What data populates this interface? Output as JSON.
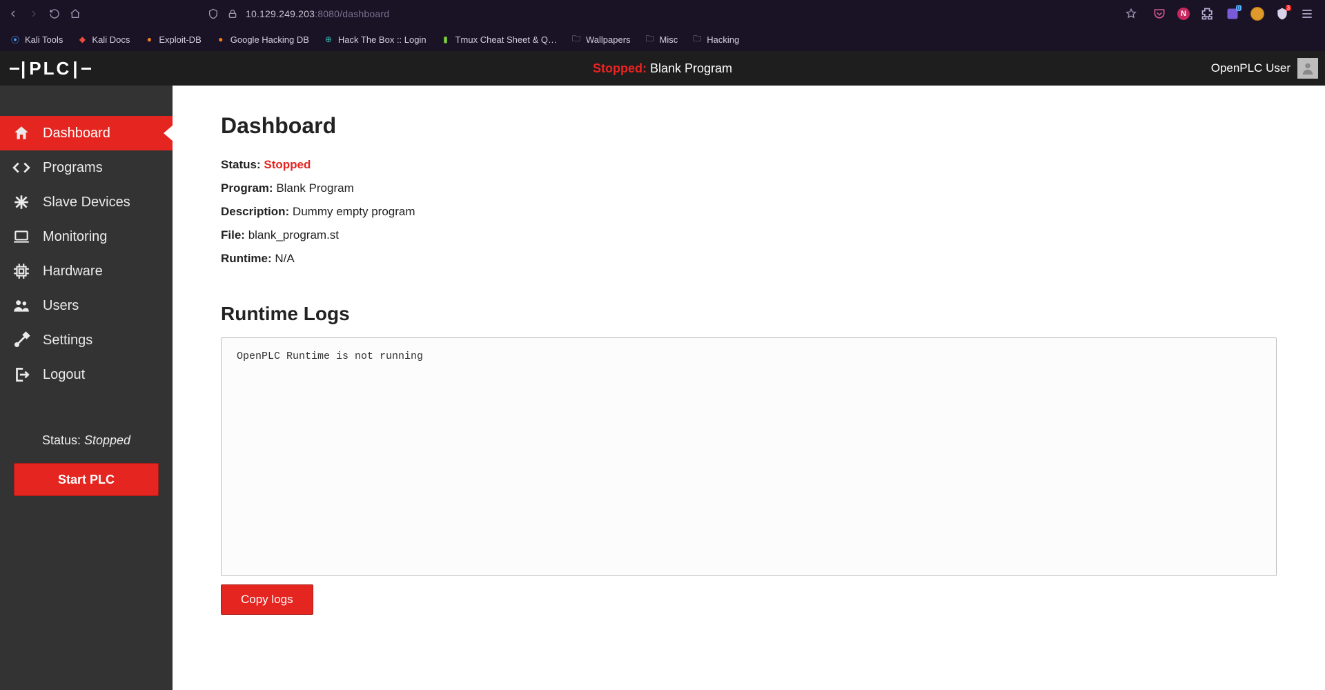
{
  "browser": {
    "url_host": "10.129.249.203",
    "url_port": ":8080",
    "url_path": "/dashboard",
    "bookmarks": [
      {
        "label": "Kali Tools",
        "favClass": "fav-blue",
        "glyph": "⦿"
      },
      {
        "label": "Kali Docs",
        "favClass": "fav-red",
        "glyph": "◆"
      },
      {
        "label": "Exploit-DB",
        "favClass": "fav-orange",
        "glyph": "●"
      },
      {
        "label": "Google Hacking DB",
        "favClass": "fav-orange",
        "glyph": "●"
      },
      {
        "label": "Hack The Box :: Login",
        "favClass": "fav-teal",
        "glyph": "⊕"
      },
      {
        "label": "Tmux Cheat Sheet & Q…",
        "favClass": "fav-green",
        "glyph": "▮"
      },
      {
        "label": "Wallpapers",
        "favClass": "fav-folder",
        "glyph": "🗀"
      },
      {
        "label": "Misc",
        "favClass": "fav-folder",
        "glyph": "🗀"
      },
      {
        "label": "Hacking",
        "favClass": "fav-folder",
        "glyph": "🗀"
      }
    ]
  },
  "header": {
    "logo_text": "PLC",
    "status_word": "Stopped:",
    "program_name": "Blank Program",
    "user_label": "OpenPLC User"
  },
  "sidebar": {
    "items": [
      {
        "label": "Dashboard",
        "icon": "home",
        "active": true
      },
      {
        "label": "Programs",
        "icon": "code",
        "active": false
      },
      {
        "label": "Slave Devices",
        "icon": "asterisk",
        "active": false
      },
      {
        "label": "Monitoring",
        "icon": "laptop",
        "active": false
      },
      {
        "label": "Hardware",
        "icon": "chip",
        "active": false
      },
      {
        "label": "Users",
        "icon": "users",
        "active": false
      },
      {
        "label": "Settings",
        "icon": "settings",
        "active": false
      },
      {
        "label": "Logout",
        "icon": "logout",
        "active": false
      }
    ],
    "status_prefix": "Status: ",
    "status_value": "Stopped",
    "start_button": "Start PLC"
  },
  "dashboard": {
    "title": "Dashboard",
    "rows": {
      "status_label": "Status:",
      "status_value": "Stopped",
      "program_label": "Program:",
      "program_value": "Blank Program",
      "desc_label": "Description:",
      "desc_value": "Dummy empty program",
      "file_label": "File:",
      "file_value": "blank_program.st",
      "runtime_label": "Runtime:",
      "runtime_value": "N/A"
    },
    "logs_title": "Runtime Logs",
    "logs_text": "OpenPLC Runtime is not running",
    "copy_button": "Copy logs"
  }
}
